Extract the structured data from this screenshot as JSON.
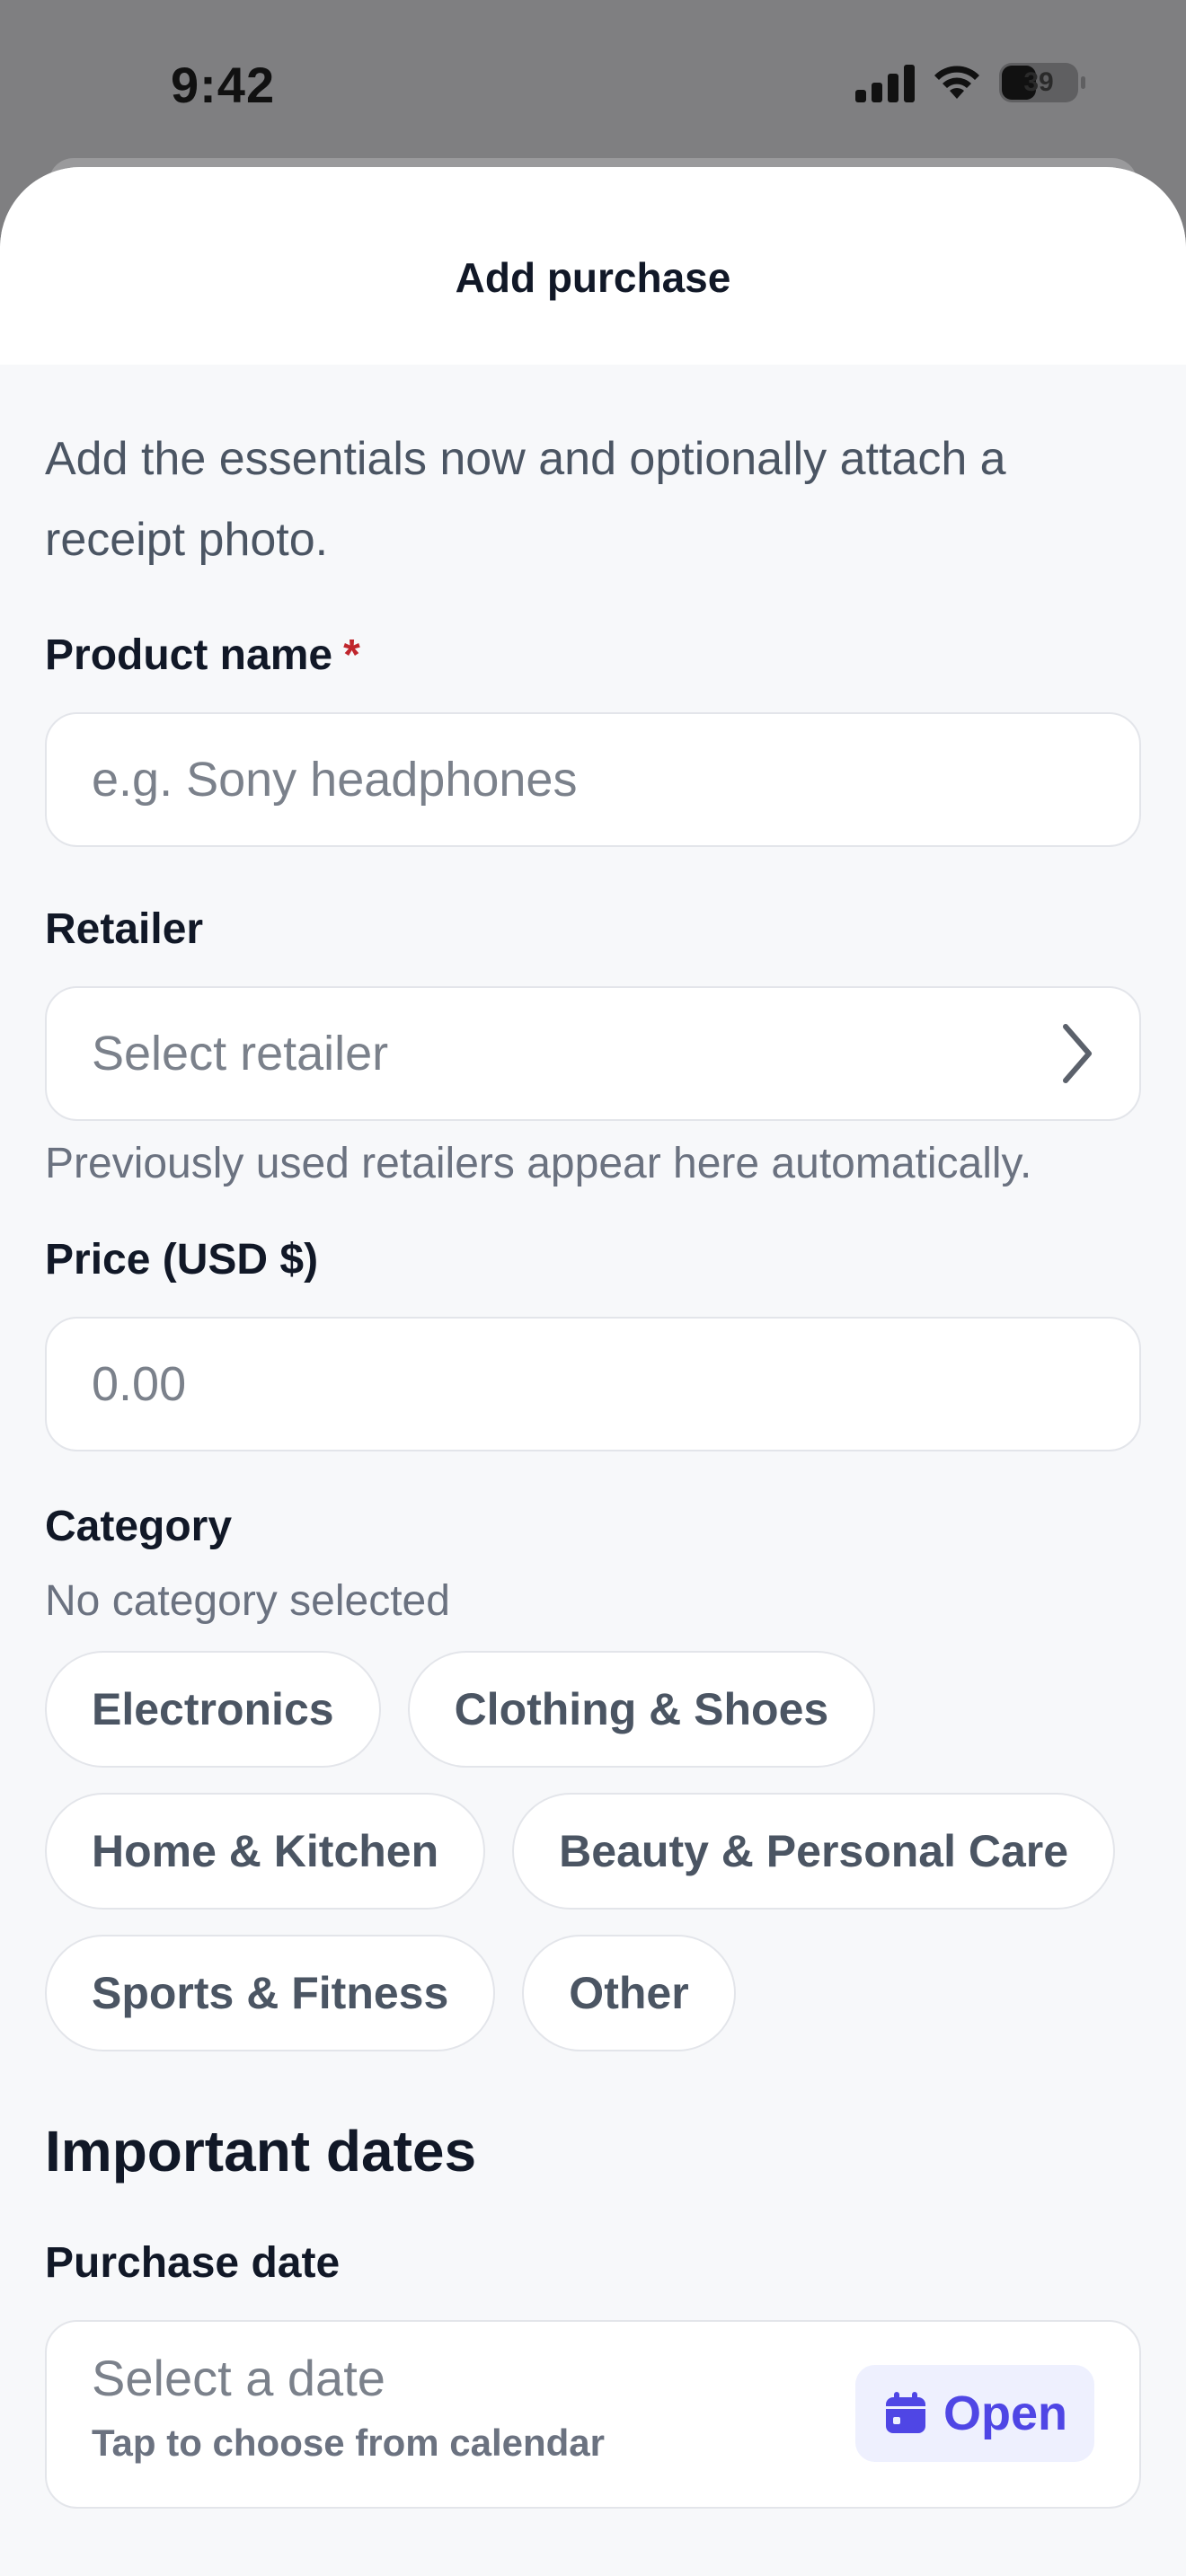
{
  "status": {
    "time": "9:42",
    "battery": "39"
  },
  "sheet": {
    "title": "Add purchase",
    "intro": "Add the essentials now and optionally attach a receipt photo."
  },
  "form": {
    "product_name": {
      "label": "Product name",
      "required_mark": "*",
      "placeholder": "e.g. Sony headphones"
    },
    "retailer": {
      "label": "Retailer",
      "placeholder": "Select retailer",
      "hint": "Previously used retailers appear here automatically."
    },
    "price": {
      "label": "Price (USD $)",
      "placeholder": "0.00"
    },
    "category": {
      "label": "Category",
      "status": "No category selected",
      "options": [
        "Electronics",
        "Clothing & Shoes",
        "Home & Kitchen",
        "Beauty & Personal Care",
        "Sports & Fitness",
        "Other"
      ]
    }
  },
  "dates": {
    "section_title": "Important dates",
    "purchase_date": {
      "label": "Purchase date",
      "placeholder": "Select a date",
      "sub": "Tap to choose from calendar",
      "button": "Open"
    }
  },
  "colors": {
    "accent": "#4f46e5",
    "required": "#c0262d"
  }
}
